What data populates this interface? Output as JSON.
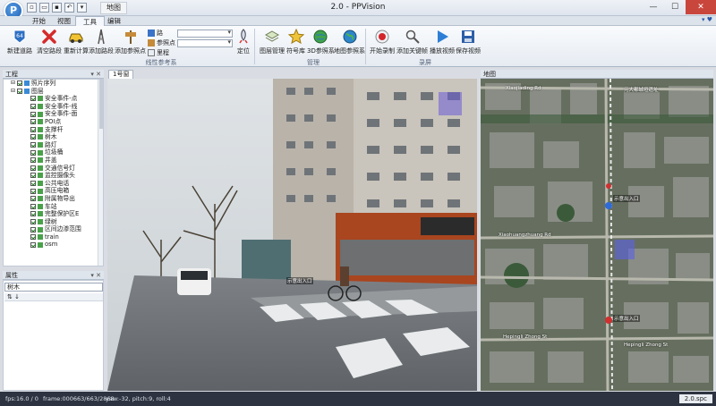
{
  "window": {
    "title": "2.0 - PPVision",
    "context_tab": "地图",
    "logo_letter": "P",
    "minimize": "—",
    "maximize": "☐",
    "close": "✕"
  },
  "tabs": [
    {
      "label": "开始"
    },
    {
      "label": "视图"
    },
    {
      "label": "工具",
      "active": true
    },
    {
      "label": "编辑"
    }
  ],
  "tabbar_right": "▾ ♥",
  "ribbon": {
    "groups": [
      {
        "label": "线性参考系"
      },
      {
        "label": "管理"
      },
      {
        "label": "录屏"
      }
    ],
    "buttons_linear": [
      {
        "label": "新建道路",
        "icon": "road-64-icon"
      },
      {
        "label": "清空路段",
        "icon": "red-x-icon"
      },
      {
        "label": "重新计算",
        "icon": "car-icon"
      },
      {
        "label": "添加路段",
        "icon": "road-add-icon"
      },
      {
        "label": "添加参照点",
        "icon": "signpost-icon"
      }
    ],
    "small_items": [
      {
        "label": "路"
      },
      {
        "label": "参照点"
      },
      {
        "label": "里程"
      }
    ],
    "combo_values": [
      "",
      ""
    ],
    "locate_button": "定位",
    "buttons_manage": [
      {
        "label": "图层管理",
        "icon": "layers-icon"
      },
      {
        "label": "符号库",
        "icon": "star-icon"
      },
      {
        "label": "3D参照系",
        "icon": "globe-3d-icon"
      },
      {
        "label": "地图参照系",
        "icon": "globe-map-icon"
      }
    ],
    "buttons_record": [
      {
        "label": "开始录制",
        "icon": "record-icon"
      },
      {
        "label": "添加关键帧",
        "icon": "keyframe-icon"
      },
      {
        "label": "播放视频",
        "icon": "play-icon"
      },
      {
        "label": "保存视频",
        "icon": "save-icon"
      }
    ]
  },
  "project_pane": {
    "title": "工程",
    "pin": "▾ ✕",
    "tree": [
      {
        "label": "照片序列",
        "level": 1,
        "checked": true,
        "kind": "folder"
      },
      {
        "label": "图层",
        "level": 1,
        "checked": true,
        "kind": "folder"
      },
      {
        "label": "安全事件-点",
        "level": 2,
        "checked": true
      },
      {
        "label": "安全事件-线",
        "level": 2,
        "checked": true
      },
      {
        "label": "安全事件-面",
        "level": 2,
        "checked": true
      },
      {
        "label": "POI点",
        "level": 2,
        "checked": true
      },
      {
        "label": "支撑杆",
        "level": 2,
        "checked": true
      },
      {
        "label": "树木",
        "level": 2,
        "checked": true
      },
      {
        "label": "路灯",
        "level": 2,
        "checked": true
      },
      {
        "label": "垃圾桶",
        "level": 2,
        "checked": true
      },
      {
        "label": "井盖",
        "level": 2,
        "checked": true
      },
      {
        "label": "交通信号灯",
        "level": 2,
        "checked": true
      },
      {
        "label": "监控摄像头",
        "level": 2,
        "checked": true
      },
      {
        "label": "公共电话",
        "level": 2,
        "checked": true
      },
      {
        "label": "高压电箱",
        "level": 2,
        "checked": true
      },
      {
        "label": "附属物导出",
        "level": 2,
        "checked": true
      },
      {
        "label": "车站",
        "level": 2,
        "checked": true
      },
      {
        "label": "完整保护区E",
        "level": 2,
        "checked": true
      },
      {
        "label": "绿树",
        "level": 2,
        "checked": true
      },
      {
        "label": "区间边渗范围",
        "level": 2,
        "checked": true
      },
      {
        "label": "train",
        "level": 2,
        "checked": true
      },
      {
        "label": "osm",
        "level": 2,
        "checked": true
      }
    ]
  },
  "properties_pane": {
    "title": "属性",
    "pin": "▾ ✕",
    "selected": "树木",
    "tools": "⇅ ↓"
  },
  "camera_view": {
    "tab": "1号窗",
    "annotation": "示意出入口"
  },
  "map_view": {
    "title": "地图",
    "labels": [
      "Xiaojiading Rd",
      "元大都城垣遗址",
      "Xiaohuangzhuang Rd",
      "Hepingli Zhong St",
      "Hepingli Zhong St",
      "示意出入口",
      "示意出入口"
    ]
  },
  "status": {
    "fps": "fps:16.0 / 0",
    "frame": "frame:000663/663/2868",
    "pose": "yaw:-32, pitch:9, roll:4",
    "version": "2.0.spc"
  },
  "colors": {
    "record_red": "#d3242a",
    "accent_blue": "#2a5aa8"
  }
}
